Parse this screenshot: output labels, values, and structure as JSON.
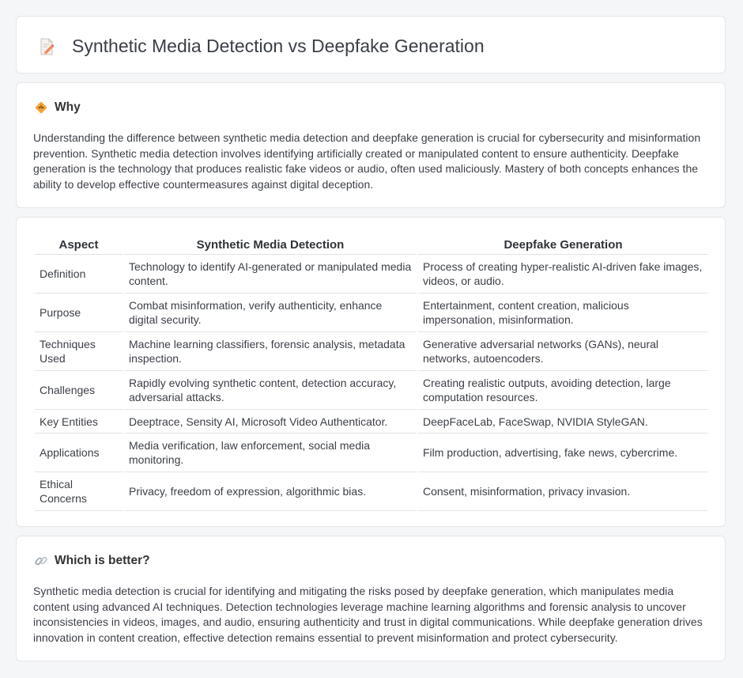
{
  "header": {
    "title": "Synthetic Media Detection vs Deepfake Generation"
  },
  "why": {
    "heading": "Why",
    "body": "Understanding the difference between synthetic media detection and deepfake generation is crucial for cybersecurity and misinformation prevention. Synthetic media detection involves identifying artificially created or manipulated content to ensure authenticity. Deepfake generation is the technology that produces realistic fake videos or audio, often used maliciously. Mastery of both concepts enhances the ability to develop effective countermeasures against digital deception."
  },
  "table": {
    "headers": [
      "Aspect",
      "Synthetic Media Detection",
      "Deepfake Generation"
    ],
    "rows": [
      {
        "aspect": "Definition",
        "detection": "Technology to identify AI-generated or manipulated media content.",
        "generation": "Process of creating hyper-realistic AI-driven fake images, videos, or audio."
      },
      {
        "aspect": "Purpose",
        "detection": "Combat misinformation, verify authenticity, enhance digital security.",
        "generation": "Entertainment, content creation, malicious impersonation, misinformation."
      },
      {
        "aspect": "Techniques Used",
        "detection": "Machine learning classifiers, forensic analysis, metadata inspection.",
        "generation": "Generative adversarial networks (GANs), neural networks, autoencoders."
      },
      {
        "aspect": "Challenges",
        "detection": "Rapidly evolving synthetic content, detection accuracy, adversarial attacks.",
        "generation": "Creating realistic outputs, avoiding detection, large computation resources."
      },
      {
        "aspect": "Key Entities",
        "detection": "Deeptrace, Sensity AI, Microsoft Video Authenticator.",
        "generation": "DeepFaceLab, FaceSwap, NVIDIA StyleGAN."
      },
      {
        "aspect": "Applications",
        "detection": "Media verification, law enforcement, social media monitoring.",
        "generation": "Film production, advertising, fake news, cybercrime."
      },
      {
        "aspect": "Ethical Concerns",
        "detection": "Privacy, freedom of expression, algorithmic bias.",
        "generation": "Consent, misinformation, privacy invasion."
      }
    ]
  },
  "better": {
    "heading": "Which is better?",
    "body": "Synthetic media detection is crucial for identifying and mitigating the risks posed by deepfake generation, which manipulates media content using advanced AI techniques. Detection technologies leverage machine learning algorithms and forensic analysis to uncover inconsistencies in videos, images, and audio, ensuring authenticity and trust in digital communications. While deepfake generation drives innovation in content creation, effective detection remains essential to prevent misinformation and protect cybersecurity."
  },
  "icons": {
    "title": "document-pencil-icon",
    "why": "diamond-warning-icon",
    "better": "link-icon"
  },
  "colors": {
    "background": "#f5f6f8",
    "card": "#ffffff",
    "accent_orange": "#f0a03c",
    "title_text": "#3a3f47"
  }
}
